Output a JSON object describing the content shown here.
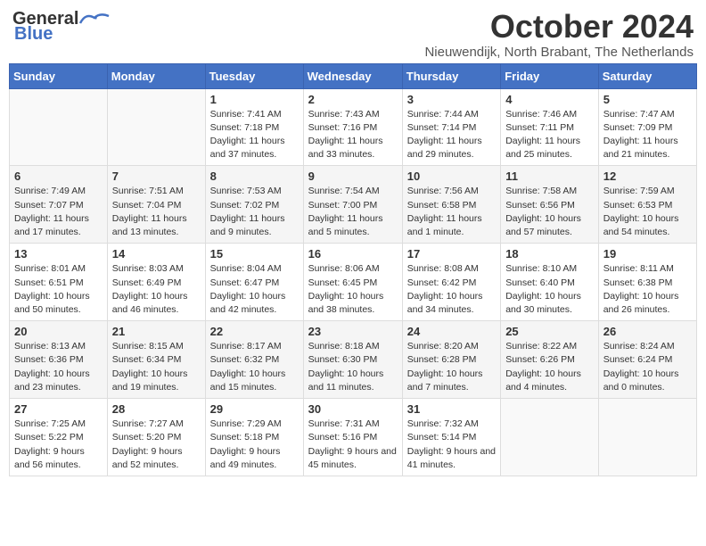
{
  "header": {
    "logo_general": "General",
    "logo_blue": "Blue",
    "month_title": "October 2024",
    "location": "Nieuwendijk, North Brabant, The Netherlands"
  },
  "weekdays": [
    "Sunday",
    "Monday",
    "Tuesday",
    "Wednesday",
    "Thursday",
    "Friday",
    "Saturday"
  ],
  "weeks": [
    [
      {
        "day": "",
        "sunrise": "",
        "sunset": "",
        "daylight": ""
      },
      {
        "day": "",
        "sunrise": "",
        "sunset": "",
        "daylight": ""
      },
      {
        "day": "1",
        "sunrise": "Sunrise: 7:41 AM",
        "sunset": "Sunset: 7:18 PM",
        "daylight": "Daylight: 11 hours and 37 minutes."
      },
      {
        "day": "2",
        "sunrise": "Sunrise: 7:43 AM",
        "sunset": "Sunset: 7:16 PM",
        "daylight": "Daylight: 11 hours and 33 minutes."
      },
      {
        "day": "3",
        "sunrise": "Sunrise: 7:44 AM",
        "sunset": "Sunset: 7:14 PM",
        "daylight": "Daylight: 11 hours and 29 minutes."
      },
      {
        "day": "4",
        "sunrise": "Sunrise: 7:46 AM",
        "sunset": "Sunset: 7:11 PM",
        "daylight": "Daylight: 11 hours and 25 minutes."
      },
      {
        "day": "5",
        "sunrise": "Sunrise: 7:47 AM",
        "sunset": "Sunset: 7:09 PM",
        "daylight": "Daylight: 11 hours and 21 minutes."
      }
    ],
    [
      {
        "day": "6",
        "sunrise": "Sunrise: 7:49 AM",
        "sunset": "Sunset: 7:07 PM",
        "daylight": "Daylight: 11 hours and 17 minutes."
      },
      {
        "day": "7",
        "sunrise": "Sunrise: 7:51 AM",
        "sunset": "Sunset: 7:04 PM",
        "daylight": "Daylight: 11 hours and 13 minutes."
      },
      {
        "day": "8",
        "sunrise": "Sunrise: 7:53 AM",
        "sunset": "Sunset: 7:02 PM",
        "daylight": "Daylight: 11 hours and 9 minutes."
      },
      {
        "day": "9",
        "sunrise": "Sunrise: 7:54 AM",
        "sunset": "Sunset: 7:00 PM",
        "daylight": "Daylight: 11 hours and 5 minutes."
      },
      {
        "day": "10",
        "sunrise": "Sunrise: 7:56 AM",
        "sunset": "Sunset: 6:58 PM",
        "daylight": "Daylight: 11 hours and 1 minute."
      },
      {
        "day": "11",
        "sunrise": "Sunrise: 7:58 AM",
        "sunset": "Sunset: 6:56 PM",
        "daylight": "Daylight: 10 hours and 57 minutes."
      },
      {
        "day": "12",
        "sunrise": "Sunrise: 7:59 AM",
        "sunset": "Sunset: 6:53 PM",
        "daylight": "Daylight: 10 hours and 54 minutes."
      }
    ],
    [
      {
        "day": "13",
        "sunrise": "Sunrise: 8:01 AM",
        "sunset": "Sunset: 6:51 PM",
        "daylight": "Daylight: 10 hours and 50 minutes."
      },
      {
        "day": "14",
        "sunrise": "Sunrise: 8:03 AM",
        "sunset": "Sunset: 6:49 PM",
        "daylight": "Daylight: 10 hours and 46 minutes."
      },
      {
        "day": "15",
        "sunrise": "Sunrise: 8:04 AM",
        "sunset": "Sunset: 6:47 PM",
        "daylight": "Daylight: 10 hours and 42 minutes."
      },
      {
        "day": "16",
        "sunrise": "Sunrise: 8:06 AM",
        "sunset": "Sunset: 6:45 PM",
        "daylight": "Daylight: 10 hours and 38 minutes."
      },
      {
        "day": "17",
        "sunrise": "Sunrise: 8:08 AM",
        "sunset": "Sunset: 6:42 PM",
        "daylight": "Daylight: 10 hours and 34 minutes."
      },
      {
        "day": "18",
        "sunrise": "Sunrise: 8:10 AM",
        "sunset": "Sunset: 6:40 PM",
        "daylight": "Daylight: 10 hours and 30 minutes."
      },
      {
        "day": "19",
        "sunrise": "Sunrise: 8:11 AM",
        "sunset": "Sunset: 6:38 PM",
        "daylight": "Daylight: 10 hours and 26 minutes."
      }
    ],
    [
      {
        "day": "20",
        "sunrise": "Sunrise: 8:13 AM",
        "sunset": "Sunset: 6:36 PM",
        "daylight": "Daylight: 10 hours and 23 minutes."
      },
      {
        "day": "21",
        "sunrise": "Sunrise: 8:15 AM",
        "sunset": "Sunset: 6:34 PM",
        "daylight": "Daylight: 10 hours and 19 minutes."
      },
      {
        "day": "22",
        "sunrise": "Sunrise: 8:17 AM",
        "sunset": "Sunset: 6:32 PM",
        "daylight": "Daylight: 10 hours and 15 minutes."
      },
      {
        "day": "23",
        "sunrise": "Sunrise: 8:18 AM",
        "sunset": "Sunset: 6:30 PM",
        "daylight": "Daylight: 10 hours and 11 minutes."
      },
      {
        "day": "24",
        "sunrise": "Sunrise: 8:20 AM",
        "sunset": "Sunset: 6:28 PM",
        "daylight": "Daylight: 10 hours and 7 minutes."
      },
      {
        "day": "25",
        "sunrise": "Sunrise: 8:22 AM",
        "sunset": "Sunset: 6:26 PM",
        "daylight": "Daylight: 10 hours and 4 minutes."
      },
      {
        "day": "26",
        "sunrise": "Sunrise: 8:24 AM",
        "sunset": "Sunset: 6:24 PM",
        "daylight": "Daylight: 10 hours and 0 minutes."
      }
    ],
    [
      {
        "day": "27",
        "sunrise": "Sunrise: 7:25 AM",
        "sunset": "Sunset: 5:22 PM",
        "daylight": "Daylight: 9 hours and 56 minutes."
      },
      {
        "day": "28",
        "sunrise": "Sunrise: 7:27 AM",
        "sunset": "Sunset: 5:20 PM",
        "daylight": "Daylight: 9 hours and 52 minutes."
      },
      {
        "day": "29",
        "sunrise": "Sunrise: 7:29 AM",
        "sunset": "Sunset: 5:18 PM",
        "daylight": "Daylight: 9 hours and 49 minutes."
      },
      {
        "day": "30",
        "sunrise": "Sunrise: 7:31 AM",
        "sunset": "Sunset: 5:16 PM",
        "daylight": "Daylight: 9 hours and 45 minutes."
      },
      {
        "day": "31",
        "sunrise": "Sunrise: 7:32 AM",
        "sunset": "Sunset: 5:14 PM",
        "daylight": "Daylight: 9 hours and 41 minutes."
      },
      {
        "day": "",
        "sunrise": "",
        "sunset": "",
        "daylight": ""
      },
      {
        "day": "",
        "sunrise": "",
        "sunset": "",
        "daylight": ""
      }
    ]
  ]
}
